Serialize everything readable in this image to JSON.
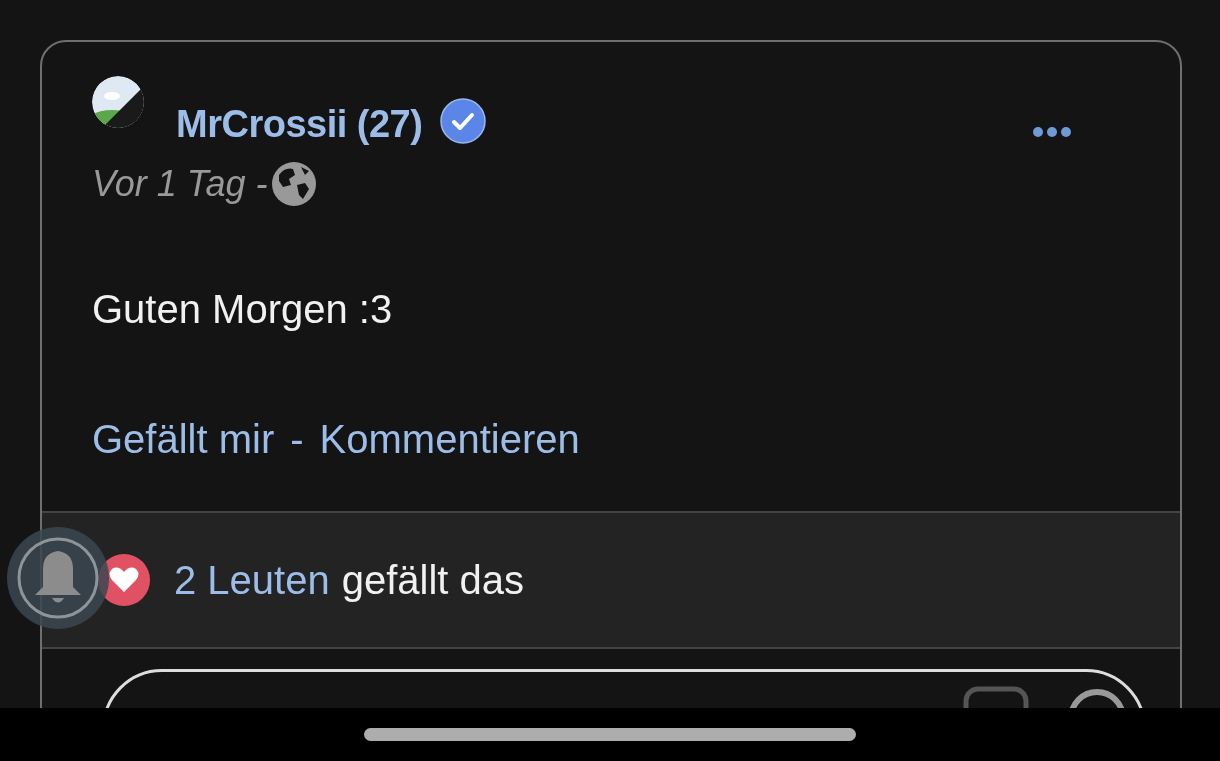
{
  "post": {
    "author": "MrCrossii (27)",
    "verified": true,
    "time": "Vor 1 Tag -",
    "text": "Guten Morgen :3",
    "actions": [
      {
        "kind": "link",
        "label": "Gefällt mir"
      },
      {
        "kind": "separator",
        "label": "-"
      },
      {
        "kind": "link",
        "label": "Kommentieren"
      }
    ]
  },
  "likes": {
    "count": "2 Leuten",
    "text": "gefällt das"
  }
}
